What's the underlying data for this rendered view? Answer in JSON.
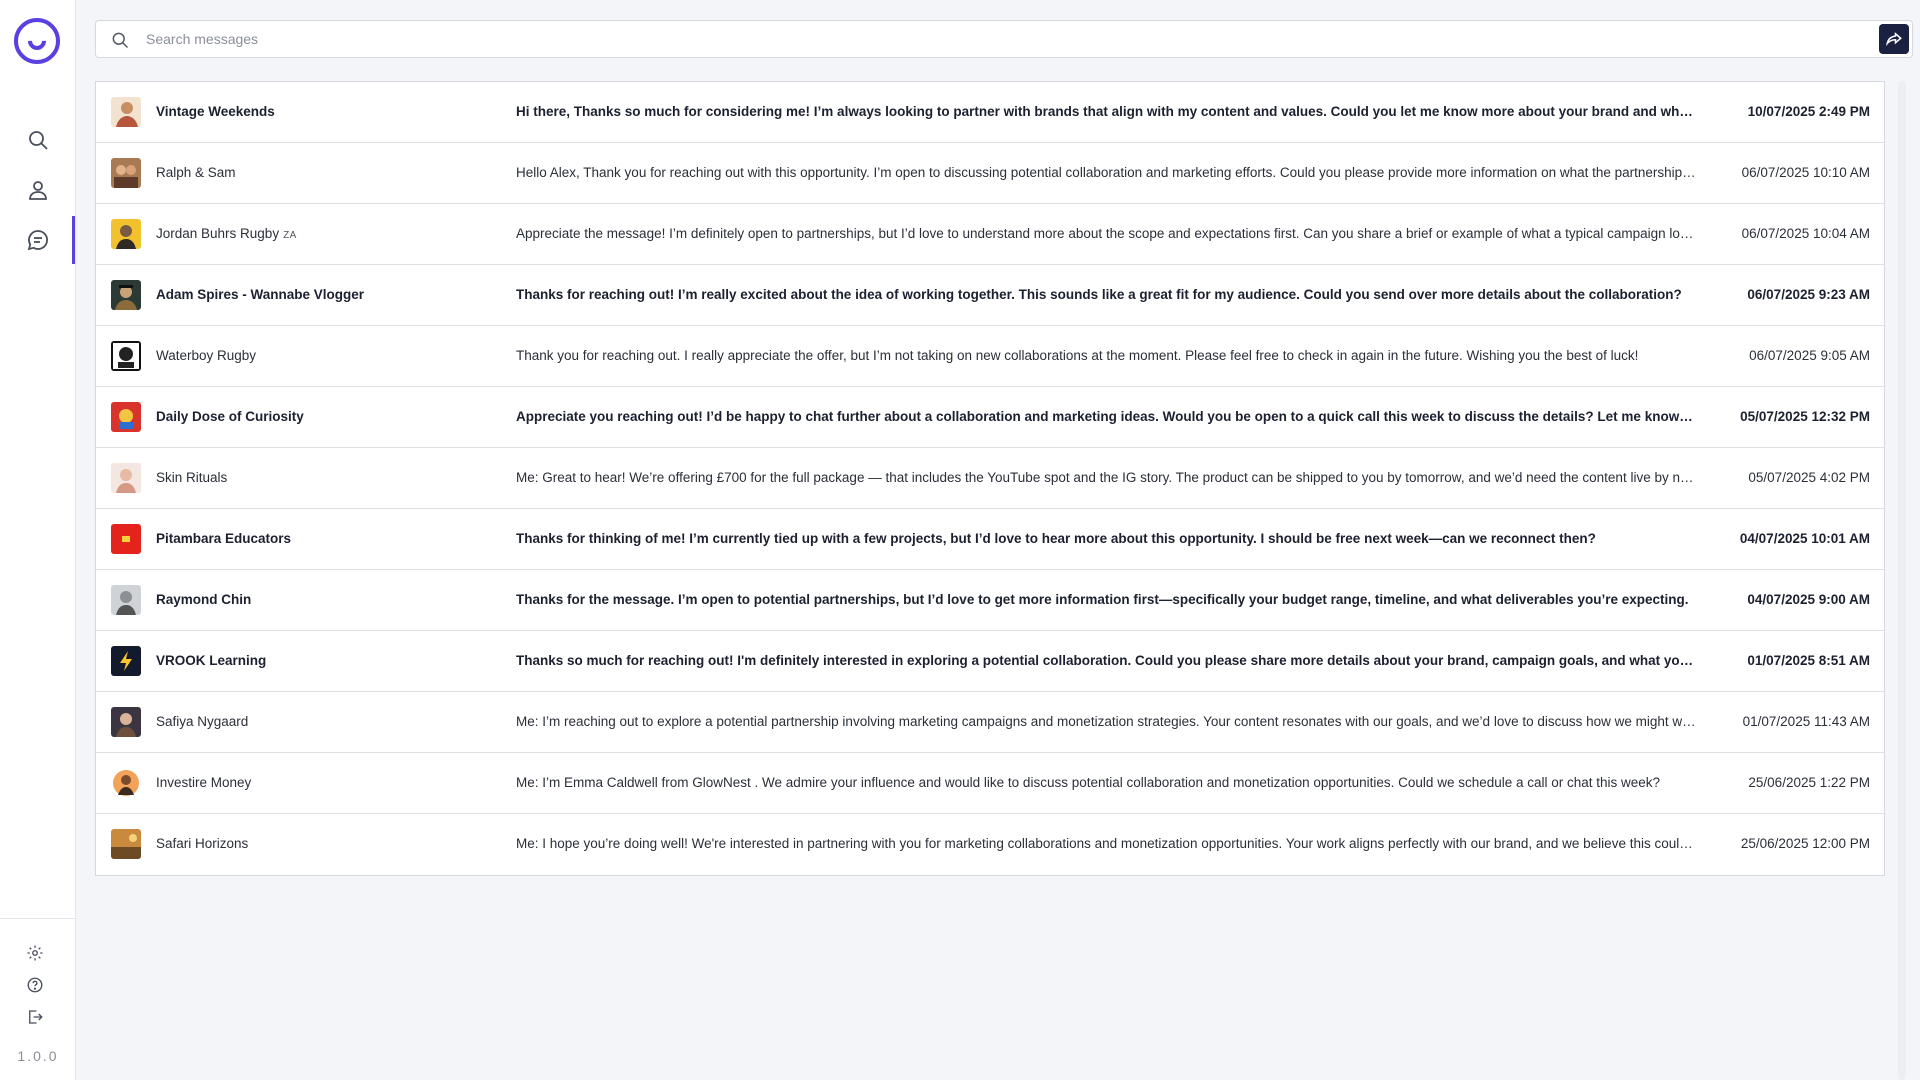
{
  "app": {
    "version": "1.0.0",
    "accent": "#5b3fe0"
  },
  "sidebar": {
    "nav": [
      {
        "icon": "search-icon"
      },
      {
        "icon": "user-icon"
      },
      {
        "icon": "chat-icon",
        "active": true
      }
    ],
    "bottom": [
      {
        "icon": "gear-icon"
      },
      {
        "icon": "help-icon"
      },
      {
        "icon": "logout-icon"
      }
    ]
  },
  "search": {
    "placeholder": "Search messages",
    "value": ""
  },
  "conversations": [
    {
      "name": "Vintage Weekends",
      "tag": "",
      "unread": true,
      "avatar": "avatar-woman-warm",
      "message": "Hi there, Thanks so much for considering me! I’m always looking to partner with brands that align with my content and values. Could you let me know more about your brand and what kind of collaboration you have in mind?",
      "date": "10/07/2025 2:49 PM"
    },
    {
      "name": "Ralph & Sam",
      "tag": "",
      "unread": false,
      "avatar": "avatar-duo-brown",
      "message": "Hello Alex, Thank you for reaching out with this opportunity. I’m open to discussing potential collaboration and marketing efforts. Could you please provide more information on what the partnership involves?",
      "date": "06/07/2025 10:10 AM"
    },
    {
      "name": "Jordan Buhrs Rugby",
      "tag": "ZA",
      "unread": false,
      "avatar": "avatar-man-yellow",
      "message": "Appreciate the message! I’m definitely open to partnerships, but I’d love to understand more about the scope and expectations first. Can you share a brief or example of what a typical campaign looks like?",
      "date": "06/07/2025 10:04 AM"
    },
    {
      "name": "Adam Spires - Wannabe Vlogger",
      "tag": "",
      "unread": true,
      "avatar": "avatar-man-dark",
      "message": "Thanks for reaching out! I’m really excited about the idea of working together. This sounds like a great fit for my audience. Could you send over more details about the collaboration?",
      "date": "06/07/2025 9:23 AM"
    },
    {
      "name": "Waterboy Rugby",
      "tag": "",
      "unread": false,
      "avatar": "avatar-bw-logo",
      "message": "Thank you for reaching out. I really appreciate the offer, but I’m not taking on new collaborations at the moment. Please feel free to check in again in the future. Wishing you the best of luck!",
      "date": "06/07/2025 9:05 AM"
    },
    {
      "name": "Daily Dose of Curiosity",
      "tag": "",
      "unread": true,
      "avatar": "avatar-red-colorful",
      "message": "Appreciate you reaching out! I’d be happy to chat further about a collaboration and marketing ideas. Would you be open to a quick call this week to discuss the details? Let me know what works for you.",
      "date": "05/07/2025 12:32 PM"
    },
    {
      "name": "Skin Rituals",
      "tag": "",
      "unread": false,
      "avatar": "avatar-woman-light",
      "message": "Me: Great to hear! We’re offering £700 for the full package — that includes the YouTube spot and the IG story. The product can be shipped to you by tomorrow, and we’d need the content live by next week.",
      "date": "05/07/2025 4:02 PM"
    },
    {
      "name": "Pitambara Educators",
      "tag": "",
      "unread": true,
      "avatar": "avatar-red-flag",
      "message": "Thanks for thinking of me! I’m currently tied up with a few projects, but I’d love to hear more about this opportunity. I should be free next week—can we reconnect then?",
      "date": "04/07/2025 10:01 AM"
    },
    {
      "name": "Raymond Chin",
      "tag": "",
      "unread": true,
      "avatar": "avatar-man-grey",
      "message": "Thanks for the message. I’m open to potential partnerships, but I’d love to get more information first—specifically your budget range, timeline, and what deliverables you’re expecting.",
      "date": "04/07/2025 9:00 AM"
    },
    {
      "name": "VROOK Learning",
      "tag": "",
      "unread": true,
      "avatar": "avatar-bolt-dark",
      "message": "Thanks so much for reaching out! I'm definitely interested in exploring a potential collaboration. Could you please share more details about your brand, campaign goals, and what you have in mind?",
      "date": "01/07/2025 8:51 AM"
    },
    {
      "name": "Safiya Nygaard",
      "tag": "",
      "unread": false,
      "avatar": "avatar-woman-dark",
      "message": "Me: I’m reaching out to explore a potential partnership involving marketing campaigns and monetization strategies. Your content resonates with our goals, and we’d love to discuss how we might work together.",
      "date": "01/07/2025 11:43 AM"
    },
    {
      "name": "Investire Money",
      "tag": "",
      "unread": false,
      "avatar": "avatar-man-orange",
      "message": "Me: I’m Emma Caldwell from GlowNest . We admire your influence and would like to discuss potential collaboration and monetization opportunities. Could we schedule a call or chat this week?",
      "date": "25/06/2025 1:22 PM"
    },
    {
      "name": "Safari Horizons",
      "tag": "",
      "unread": false,
      "avatar": "avatar-landscape",
      "message": "Me: I hope you’re doing well! We're interested in partnering with you for marketing collaborations and monetization opportunities. Your work aligns perfectly with our brand, and we believe this could be great.",
      "date": "25/06/2025 12:00 PM"
    }
  ]
}
